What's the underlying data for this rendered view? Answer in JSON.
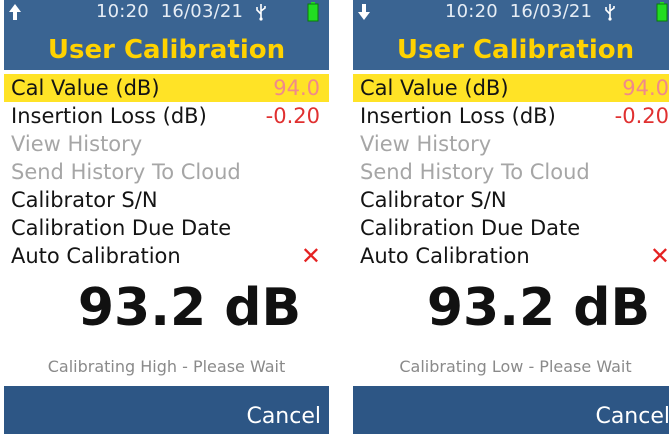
{
  "screens": [
    {
      "status": {
        "arrow": "up",
        "time": "10:20",
        "date": "16/03/21",
        "usb_icon": "usb-icon",
        "battery_icon": "battery-icon",
        "battery_color": "#22dd22"
      },
      "title": "User Calibration",
      "menu": [
        {
          "label": "Cal Value (dB)",
          "value": "94.0",
          "selected": true
        },
        {
          "label": "Insertion Loss (dB)",
          "value": "-0.20"
        },
        {
          "label": "View History",
          "disabled": true
        },
        {
          "label": "Send History To Cloud",
          "disabled": true
        },
        {
          "label": "Calibrator S/N"
        },
        {
          "label": "Calibration Due Date"
        },
        {
          "label": "Auto Calibration",
          "value": "✕"
        }
      ],
      "reading": "93.2 dB",
      "status_message": "Calibrating High - Please Wait",
      "cancel_label": "Cancel"
    },
    {
      "status": {
        "arrow": "down",
        "time": "10:20",
        "date": "16/03/21",
        "usb_icon": "usb-icon",
        "battery_icon": "battery-icon",
        "battery_color": "#22dd22"
      },
      "title": "User Calibration",
      "menu": [
        {
          "label": "Cal Value (dB)",
          "value": "94.0",
          "selected": true
        },
        {
          "label": "Insertion Loss (dB)",
          "value": "-0.20"
        },
        {
          "label": "View History",
          "disabled": true
        },
        {
          "label": "Send History To Cloud",
          "disabled": true
        },
        {
          "label": "Calibrator S/N"
        },
        {
          "label": "Calibration Due Date"
        },
        {
          "label": "Auto Calibration",
          "value": "✕"
        }
      ],
      "reading": "93.2 dB",
      "status_message": "Calibrating Low - Please Wait",
      "cancel_label": "Cancel"
    }
  ]
}
